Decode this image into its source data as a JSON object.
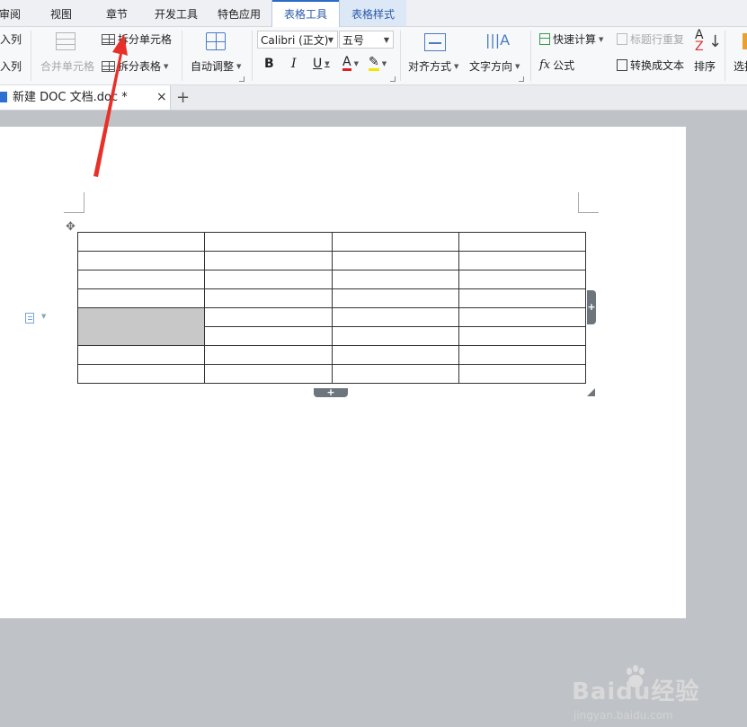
{
  "ribbon_tabs": [
    {
      "label": "审阅"
    },
    {
      "label": "视图"
    },
    {
      "label": "章节"
    },
    {
      "label": "开发工具"
    },
    {
      "label": "特色应用"
    },
    {
      "label": "表格工具"
    },
    {
      "label": "表格样式"
    }
  ],
  "ribbon": {
    "insert_col_left": "插入列",
    "insert_col_right": "插入列",
    "merge_cells": "合并单元格",
    "split_cells": "拆分单元格",
    "split_table": "拆分表格",
    "auto_fit": "自动调整",
    "font_name": "Calibri (正文)",
    "font_size": "五号",
    "bold": "B",
    "italic": "I",
    "underline": "U",
    "font_color": "A",
    "alignment": "对齐方式",
    "text_direction": "文字方向",
    "quick_calc": "快速计算",
    "header_repeat": "标题行重复",
    "formula": "公式",
    "convert_to_text": "转换成文本",
    "sort": "排序",
    "select": "选择"
  },
  "document_tab": {
    "name": "新建 DOC 文档.doc *",
    "close": "×",
    "add": "+"
  },
  "table": {
    "rows": 8,
    "cols": 4,
    "merged_cell": {
      "row": 5,
      "col": 1,
      "rowspan": 2
    }
  },
  "watermark": {
    "logo": "Baidu经验",
    "url": "jingyan.baidu.com"
  },
  "colors": {
    "accent": "#2a6bc9",
    "context_tab_bg": "#dde8f6",
    "merged_cell": "#c8c8c8",
    "arrow": "#e8302a",
    "font_color_underline": "#e02020",
    "highlight_underline": "#f5e600"
  },
  "icons": {
    "move_handle": "four-way-arrow-icon",
    "add_row": "plus-icon",
    "add_col": "plus-icon",
    "para_marker": "document-icon"
  }
}
